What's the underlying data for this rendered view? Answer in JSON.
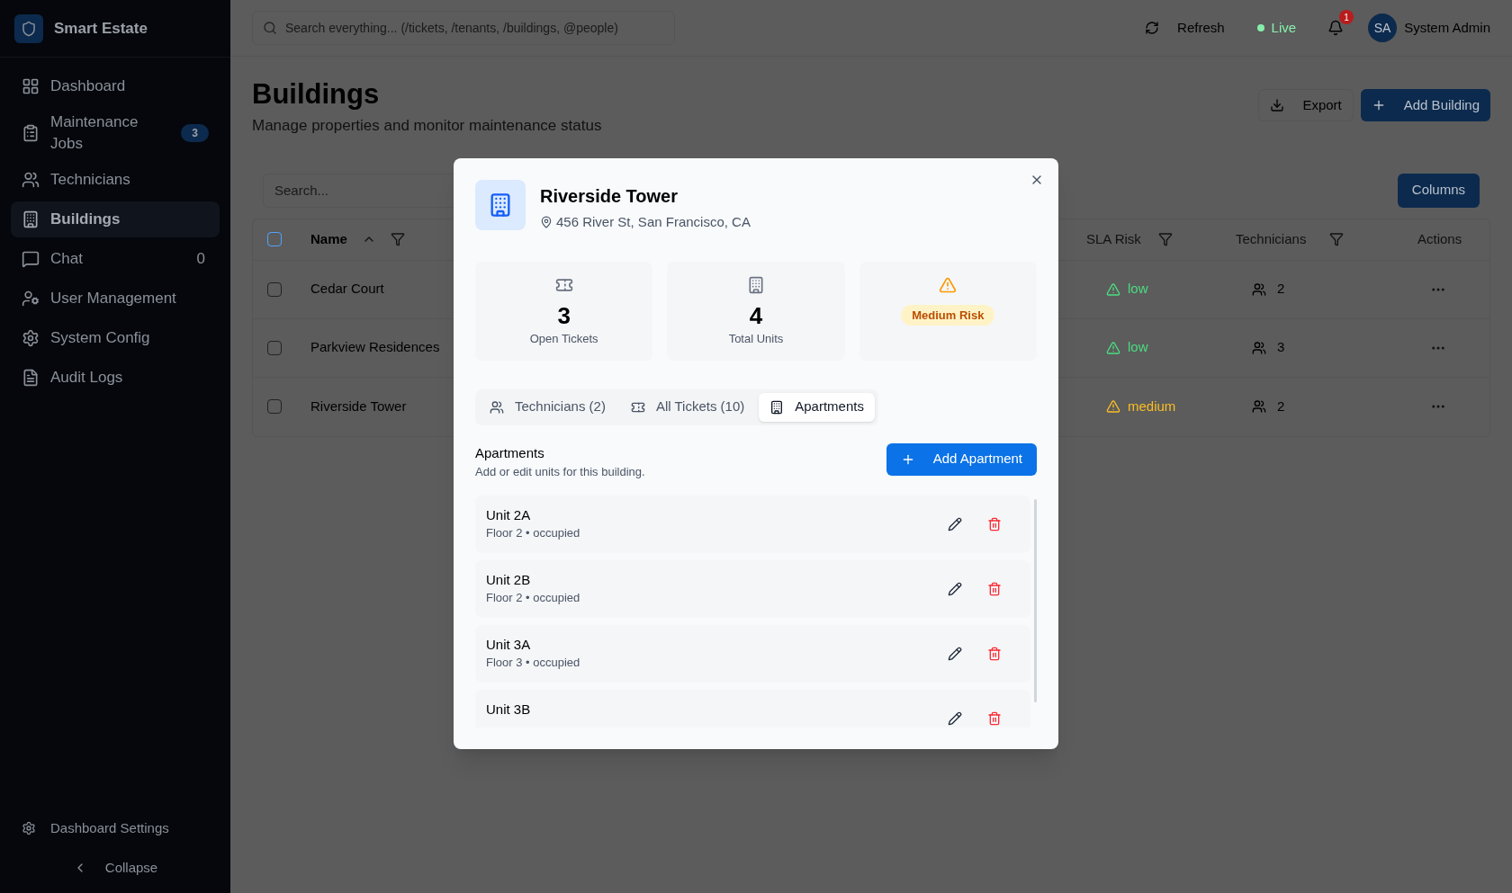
{
  "sidebar": {
    "brand": "Smart Estate",
    "items": [
      {
        "label": "Dashboard",
        "selected": false
      },
      {
        "label": "Maintenance Jobs",
        "selected": false,
        "badge": "3"
      },
      {
        "label": "Technicians",
        "selected": false
      },
      {
        "label": "Buildings",
        "selected": true
      },
      {
        "label": "Chat",
        "selected": false,
        "count": "0"
      },
      {
        "label": "User Management",
        "selected": false
      },
      {
        "label": "System Config",
        "selected": false
      },
      {
        "label": "Audit Logs",
        "selected": false
      }
    ],
    "footer": {
      "settings": "Dashboard Settings",
      "collapse": "Collapse"
    }
  },
  "topbar": {
    "search_placeholder": "Search everything... (/tickets, /tenants, /buildings, @people)",
    "refresh": "Refresh",
    "live": "Live",
    "notifications": "1",
    "avatar": "SA",
    "user": "System Admin"
  },
  "page": {
    "title": "Buildings",
    "subtitle": "Manage properties and monitor maintenance status",
    "export": "Export",
    "add": "Add Building"
  },
  "table": {
    "search_placeholder": "Search...",
    "columns_button": "Columns",
    "header_checked": false,
    "columns": {
      "name": "Name",
      "sla": "SLA Risk",
      "technicians": "Technicians",
      "actions": "Actions"
    },
    "rows": [
      {
        "checked": false,
        "name": "Cedar Court",
        "sla": {
          "text": "low",
          "color": "#4ade80"
        },
        "technicians": "2"
      },
      {
        "checked": false,
        "name": "Parkview Residences",
        "sla": {
          "text": "low",
          "color": "#4ade80"
        },
        "technicians": "3"
      },
      {
        "checked": false,
        "name": "Riverside Tower",
        "sla": {
          "text": "medium",
          "color": "#fbbf24"
        },
        "technicians": "2"
      }
    ]
  },
  "modal": {
    "title": "Riverside Tower",
    "address": "456 River St, San Francisco, CA",
    "stats": [
      {
        "kind": "number",
        "value": "3",
        "label": "Open Tickets"
      },
      {
        "kind": "number",
        "value": "4",
        "label": "Total Units"
      },
      {
        "kind": "risk",
        "label": "Medium Risk"
      }
    ],
    "tabs": [
      {
        "label": "Technicians (2)",
        "selected": false
      },
      {
        "label": "All Tickets (10)",
        "selected": false
      },
      {
        "label": "Apartments",
        "selected": true
      }
    ],
    "section_title": "Apartments",
    "section_subtitle": "Add or edit units for this building.",
    "add_button": "Add Apartment",
    "apartments": [
      {
        "name": "Unit 2A",
        "detail": "Floor 2 • occupied"
      },
      {
        "name": "Unit 2B",
        "detail": "Floor 2 • occupied"
      },
      {
        "name": "Unit 3A",
        "detail": "Floor 3 • occupied"
      },
      {
        "name": "Unit 3B"
      }
    ]
  }
}
